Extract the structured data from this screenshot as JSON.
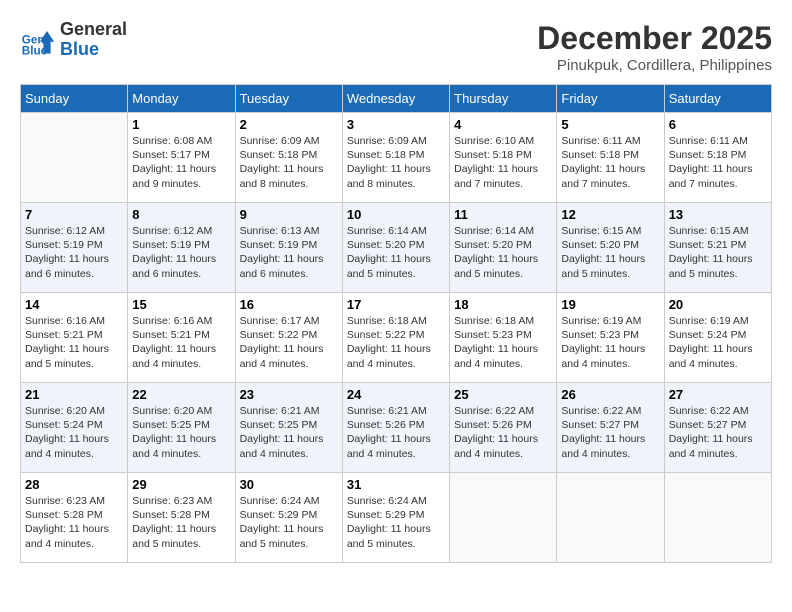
{
  "header": {
    "logo_line1": "General",
    "logo_line2": "Blue",
    "month": "December 2025",
    "location": "Pinukpuk, Cordillera, Philippines"
  },
  "weekdays": [
    "Sunday",
    "Monday",
    "Tuesday",
    "Wednesday",
    "Thursday",
    "Friday",
    "Saturday"
  ],
  "weeks": [
    [
      {
        "day": "",
        "info": ""
      },
      {
        "day": "1",
        "info": "Sunrise: 6:08 AM\nSunset: 5:17 PM\nDaylight: 11 hours\nand 9 minutes."
      },
      {
        "day": "2",
        "info": "Sunrise: 6:09 AM\nSunset: 5:18 PM\nDaylight: 11 hours\nand 8 minutes."
      },
      {
        "day": "3",
        "info": "Sunrise: 6:09 AM\nSunset: 5:18 PM\nDaylight: 11 hours\nand 8 minutes."
      },
      {
        "day": "4",
        "info": "Sunrise: 6:10 AM\nSunset: 5:18 PM\nDaylight: 11 hours\nand 7 minutes."
      },
      {
        "day": "5",
        "info": "Sunrise: 6:11 AM\nSunset: 5:18 PM\nDaylight: 11 hours\nand 7 minutes."
      },
      {
        "day": "6",
        "info": "Sunrise: 6:11 AM\nSunset: 5:18 PM\nDaylight: 11 hours\nand 7 minutes."
      }
    ],
    [
      {
        "day": "7",
        "info": "Sunrise: 6:12 AM\nSunset: 5:19 PM\nDaylight: 11 hours\nand 6 minutes."
      },
      {
        "day": "8",
        "info": "Sunrise: 6:12 AM\nSunset: 5:19 PM\nDaylight: 11 hours\nand 6 minutes."
      },
      {
        "day": "9",
        "info": "Sunrise: 6:13 AM\nSunset: 5:19 PM\nDaylight: 11 hours\nand 6 minutes."
      },
      {
        "day": "10",
        "info": "Sunrise: 6:14 AM\nSunset: 5:20 PM\nDaylight: 11 hours\nand 5 minutes."
      },
      {
        "day": "11",
        "info": "Sunrise: 6:14 AM\nSunset: 5:20 PM\nDaylight: 11 hours\nand 5 minutes."
      },
      {
        "day": "12",
        "info": "Sunrise: 6:15 AM\nSunset: 5:20 PM\nDaylight: 11 hours\nand 5 minutes."
      },
      {
        "day": "13",
        "info": "Sunrise: 6:15 AM\nSunset: 5:21 PM\nDaylight: 11 hours\nand 5 minutes."
      }
    ],
    [
      {
        "day": "14",
        "info": "Sunrise: 6:16 AM\nSunset: 5:21 PM\nDaylight: 11 hours\nand 5 minutes."
      },
      {
        "day": "15",
        "info": "Sunrise: 6:16 AM\nSunset: 5:21 PM\nDaylight: 11 hours\nand 4 minutes."
      },
      {
        "day": "16",
        "info": "Sunrise: 6:17 AM\nSunset: 5:22 PM\nDaylight: 11 hours\nand 4 minutes."
      },
      {
        "day": "17",
        "info": "Sunrise: 6:18 AM\nSunset: 5:22 PM\nDaylight: 11 hours\nand 4 minutes."
      },
      {
        "day": "18",
        "info": "Sunrise: 6:18 AM\nSunset: 5:23 PM\nDaylight: 11 hours\nand 4 minutes."
      },
      {
        "day": "19",
        "info": "Sunrise: 6:19 AM\nSunset: 5:23 PM\nDaylight: 11 hours\nand 4 minutes."
      },
      {
        "day": "20",
        "info": "Sunrise: 6:19 AM\nSunset: 5:24 PM\nDaylight: 11 hours\nand 4 minutes."
      }
    ],
    [
      {
        "day": "21",
        "info": "Sunrise: 6:20 AM\nSunset: 5:24 PM\nDaylight: 11 hours\nand 4 minutes."
      },
      {
        "day": "22",
        "info": "Sunrise: 6:20 AM\nSunset: 5:25 PM\nDaylight: 11 hours\nand 4 minutes."
      },
      {
        "day": "23",
        "info": "Sunrise: 6:21 AM\nSunset: 5:25 PM\nDaylight: 11 hours\nand 4 minutes."
      },
      {
        "day": "24",
        "info": "Sunrise: 6:21 AM\nSunset: 5:26 PM\nDaylight: 11 hours\nand 4 minutes."
      },
      {
        "day": "25",
        "info": "Sunrise: 6:22 AM\nSunset: 5:26 PM\nDaylight: 11 hours\nand 4 minutes."
      },
      {
        "day": "26",
        "info": "Sunrise: 6:22 AM\nSunset: 5:27 PM\nDaylight: 11 hours\nand 4 minutes."
      },
      {
        "day": "27",
        "info": "Sunrise: 6:22 AM\nSunset: 5:27 PM\nDaylight: 11 hours\nand 4 minutes."
      }
    ],
    [
      {
        "day": "28",
        "info": "Sunrise: 6:23 AM\nSunset: 5:28 PM\nDaylight: 11 hours\nand 4 minutes."
      },
      {
        "day": "29",
        "info": "Sunrise: 6:23 AM\nSunset: 5:28 PM\nDaylight: 11 hours\nand 5 minutes."
      },
      {
        "day": "30",
        "info": "Sunrise: 6:24 AM\nSunset: 5:29 PM\nDaylight: 11 hours\nand 5 minutes."
      },
      {
        "day": "31",
        "info": "Sunrise: 6:24 AM\nSunset: 5:29 PM\nDaylight: 11 hours\nand 5 minutes."
      },
      {
        "day": "",
        "info": ""
      },
      {
        "day": "",
        "info": ""
      },
      {
        "day": "",
        "info": ""
      }
    ]
  ]
}
